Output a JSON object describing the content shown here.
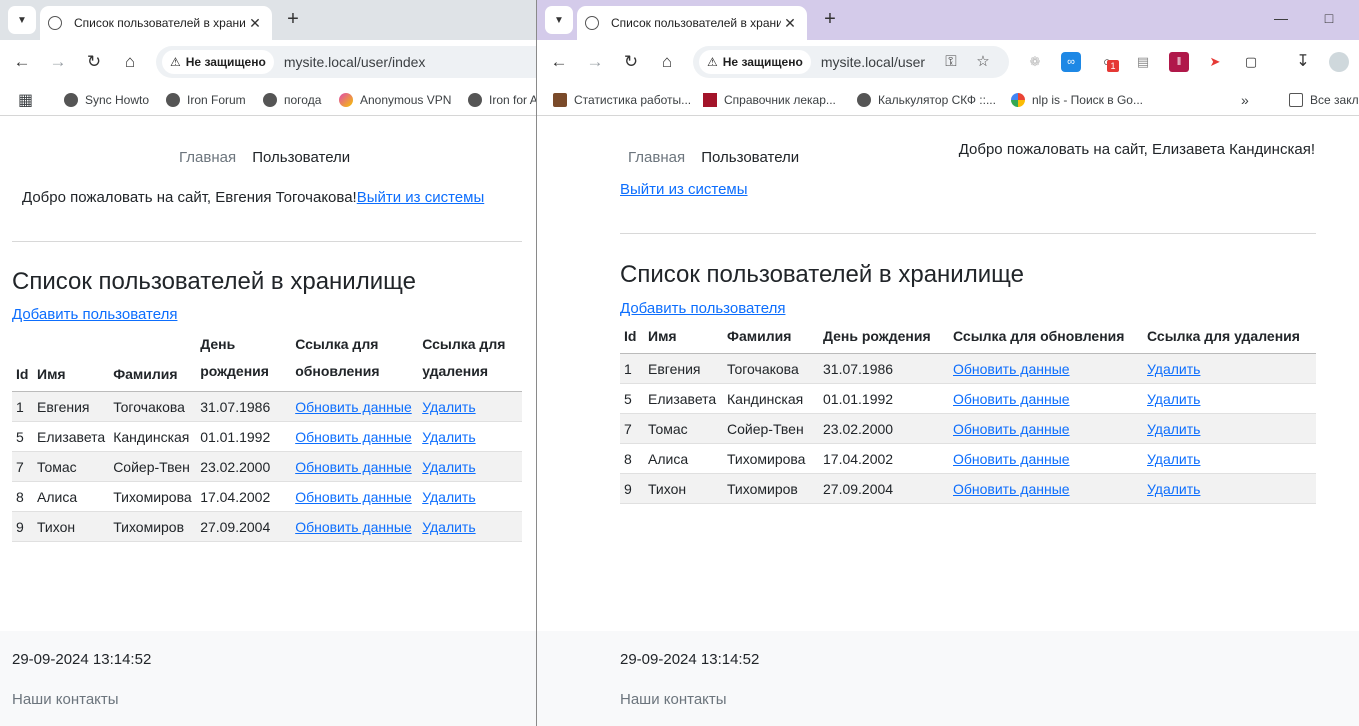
{
  "left": {
    "tab_title": "Список пользователей в хранилище",
    "not_secure": "Не защищено",
    "url": "mysite.local/user/index",
    "bookmarks": [
      "Sync Howto",
      "Iron Forum",
      "погода",
      "Anonymous VPN",
      "Iron for A"
    ],
    "nav": {
      "home": "Главная",
      "users": "Пользователи"
    },
    "welcome": "Добро пожаловать на сайт, Евгения Тогочакова!",
    "logout": "Выйти из системы",
    "heading": "Список пользователей в хранилище",
    "add_user": "Добавить пользователя",
    "headers": [
      "Id",
      "Имя",
      "Фамилия",
      "День рождения",
      "Ссылка для обновления",
      "Ссылка для удаления"
    ],
    "footer_time": "29-09-2024 13:14:52",
    "footer_contacts": "Наши контакты"
  },
  "right": {
    "tab_title": "Список пользователей в хранилище",
    "not_secure": "Не защищено",
    "url": "mysite.local/user",
    "bookmarks": [
      "Статистика работы...",
      "Справочник лекар...",
      "Калькулятор СКФ ::...",
      "nlp is - Поиск в Go..."
    ],
    "all_bookmarks": "Все закл",
    "nav": {
      "home": "Главная",
      "users": "Пользователи"
    },
    "welcome": "Добро пожаловать на сайт, Елизавета Кандинская!",
    "logout": "Выйти из системы",
    "heading": "Список пользователей в хранилище",
    "add_user": "Добавить пользователя",
    "headers": [
      "Id",
      "Имя",
      "Фамилия",
      "День рождения",
      "Ссылка для обновления",
      "Ссылка для удаления"
    ],
    "footer_time": "29-09-2024 13:14:52",
    "footer_contacts": "Наши контакты",
    "ext_badge": "1"
  },
  "users": [
    {
      "id": "1",
      "name": "Евгения",
      "surname": "Тогочакова",
      "birthday": "31.07.1986"
    },
    {
      "id": "5",
      "name": "Елизавета",
      "surname": "Кандинская",
      "birthday": "01.01.1992"
    },
    {
      "id": "7",
      "name": "Томас",
      "surname": "Сойер-Твен",
      "birthday": "23.02.2000"
    },
    {
      "id": "8",
      "name": "Алиса",
      "surname": "Тихомирова",
      "birthday": "17.04.2002"
    },
    {
      "id": "9",
      "name": "Тихон",
      "surname": "Тихомиров",
      "birthday": "27.09.2004"
    }
  ],
  "links": {
    "update": "Обновить данные",
    "delete": "Удалить"
  },
  "colors": {
    "link": "#0d6efd",
    "tabstrip_left": "#dfe3e7",
    "tabstrip_right": "#d4cbea"
  }
}
